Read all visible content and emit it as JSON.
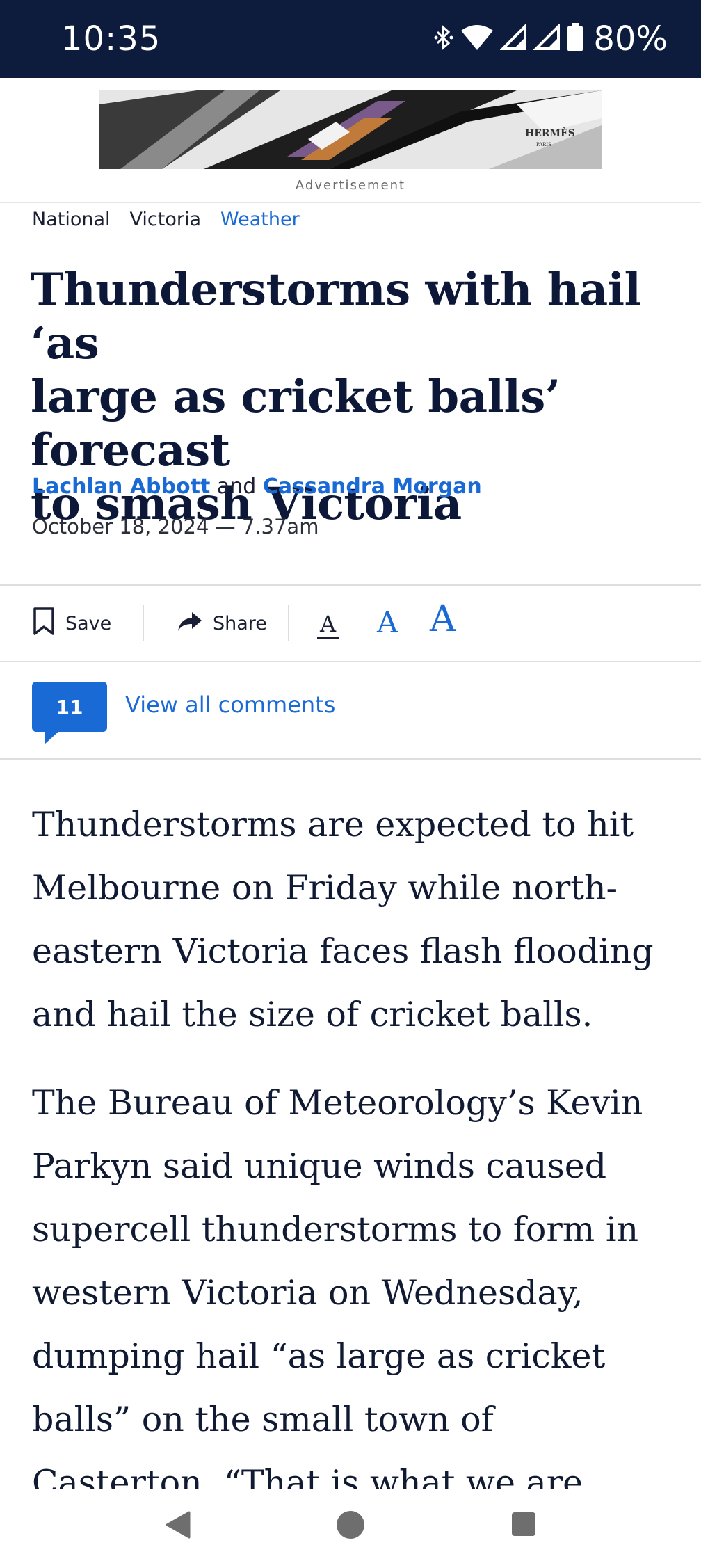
{
  "status_bar": {
    "time": "10:35",
    "battery": "80%",
    "icons": [
      "bluetooth-icon",
      "wifi-icon",
      "signal-icon",
      "signal-icon",
      "battery-icon"
    ]
  },
  "ad": {
    "label": "Advertisement",
    "brand": "HERMÈS",
    "brand_sub": "PARIS"
  },
  "breadcrumbs": [
    {
      "label": "National"
    },
    {
      "label": "Victoria"
    },
    {
      "label": "Weather"
    }
  ],
  "article": {
    "headline_lines": [
      "Thunderstorms with hail ‘as",
      "large as cricket balls’ forecast",
      "to smash Victoria"
    ],
    "author1": "Lachlan Abbott",
    "and": "and",
    "author2": "Cassandra Morgan",
    "date": "October 18, 2024 — 7.37am",
    "paragraphs": [
      [
        "Thunderstorms are expected to hit",
        "Melbourne on Friday while north-",
        "eastern Victoria faces flash flooding",
        "and hail the size of cricket balls."
      ],
      [
        "The Bureau of Meteorology’s Kevin",
        "Parkyn said unique winds caused",
        "supercell thunderstorms to form in",
        "western Victoria on Wednesday,",
        "dumping hail “as large as cricket",
        "balls” on the small town of",
        "Casterton. “That is what we are"
      ]
    ]
  },
  "toolbar": {
    "save_label": "Save",
    "share_label": "Share",
    "font_small": "A",
    "font_medium": "A",
    "font_large": "A"
  },
  "comments": {
    "count": "11",
    "link_label": "View all comments"
  },
  "colors": {
    "accent": "#1a6ad6",
    "status_bar_bg": "#0d1b3d",
    "headline": "#0d1838"
  }
}
